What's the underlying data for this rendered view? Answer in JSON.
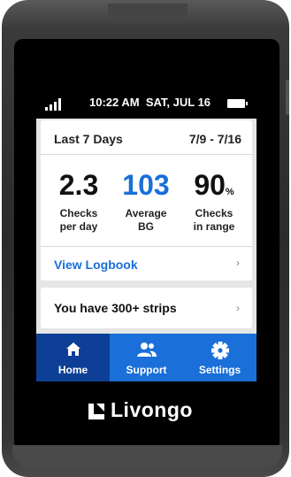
{
  "status_bar": {
    "time_date": "10:22 AM  SAT, JUL 16"
  },
  "summary": {
    "title": "Last 7 Days",
    "date_range": "7/9 - 7/16",
    "stats": [
      {
        "value": "2.3",
        "label_line1": "Checks",
        "label_line2": "per day"
      },
      {
        "value": "103",
        "label_line1": "Average",
        "label_line2": "BG"
      },
      {
        "value": "90",
        "unit": "%",
        "label_line1": "Checks",
        "label_line2": "in range"
      }
    ],
    "logbook_link": "View Logbook"
  },
  "strips_card": {
    "label": "You have 300+ strips"
  },
  "nav": {
    "items": [
      {
        "label": "Home",
        "icon": "home-icon"
      },
      {
        "label": "Support",
        "icon": "support-icon"
      },
      {
        "label": "Settings",
        "icon": "gear-icon"
      }
    ],
    "active": "Home"
  },
  "brand": {
    "name": "Livongo",
    "icon": "livongo-logo-icon"
  },
  "colors": {
    "accent": "#1a6fd8",
    "nav_active": "#0e3f96",
    "background": "#e6e6e6"
  }
}
